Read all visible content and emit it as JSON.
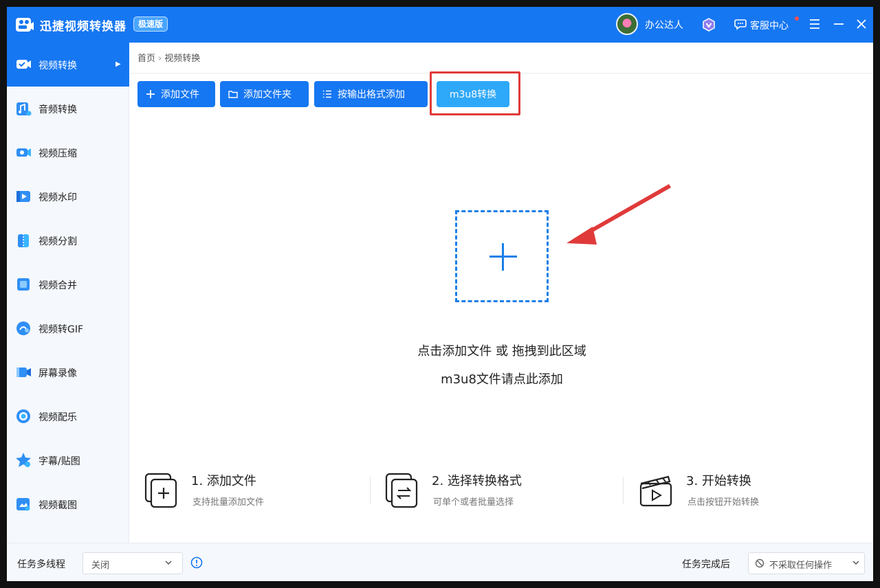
{
  "titlebar": {
    "app_title": "迅捷视频转换器",
    "edition": "极速版",
    "username": "办公达人",
    "service_label": "客服中心"
  },
  "sidebar": {
    "items": [
      {
        "label": "视频转换",
        "icon": "video-convert-icon",
        "active": true
      },
      {
        "label": "音频转换",
        "icon": "audio-convert-icon"
      },
      {
        "label": "视频压缩",
        "icon": "video-compress-icon"
      },
      {
        "label": "视频水印",
        "icon": "video-watermark-icon"
      },
      {
        "label": "视频分割",
        "icon": "video-split-icon"
      },
      {
        "label": "视频合并",
        "icon": "video-merge-icon"
      },
      {
        "label": "视频转GIF",
        "icon": "video-gif-icon"
      },
      {
        "label": "屏幕录像",
        "icon": "screen-record-icon"
      },
      {
        "label": "视频配乐",
        "icon": "video-music-icon"
      },
      {
        "label": "字幕/贴图",
        "icon": "subtitle-sticker-icon"
      },
      {
        "label": "视频截图",
        "icon": "video-screenshot-icon"
      }
    ]
  },
  "breadcrumb": {
    "home": "首页",
    "current": "视频转换"
  },
  "toolbar": {
    "add_file": "添加文件",
    "add_folder": "添加文件夹",
    "add_by_format": "按输出格式添加",
    "m3u8": "m3u8转换"
  },
  "dropzone": {
    "hint": "点击添加文件 或 拖拽到此区域",
    "hint_m3u8": "m3u8文件请点此添加"
  },
  "steps": [
    {
      "title": "1. 添加文件",
      "desc": "支持批量添加文件"
    },
    {
      "title": "2. 选择转换格式",
      "desc": "可单个或者批量选择"
    },
    {
      "title": "3. 开始转换",
      "desc": "点击按钮开始转换"
    }
  ],
  "footer": {
    "multithread_label": "任务多线程",
    "multithread_value": "关闭",
    "after_label": "任务完成后",
    "after_value": "不采取任何操作"
  },
  "colors": {
    "primary": "#1677f2",
    "accent": "#2ea8f8",
    "highlight": "#e03a3a"
  }
}
